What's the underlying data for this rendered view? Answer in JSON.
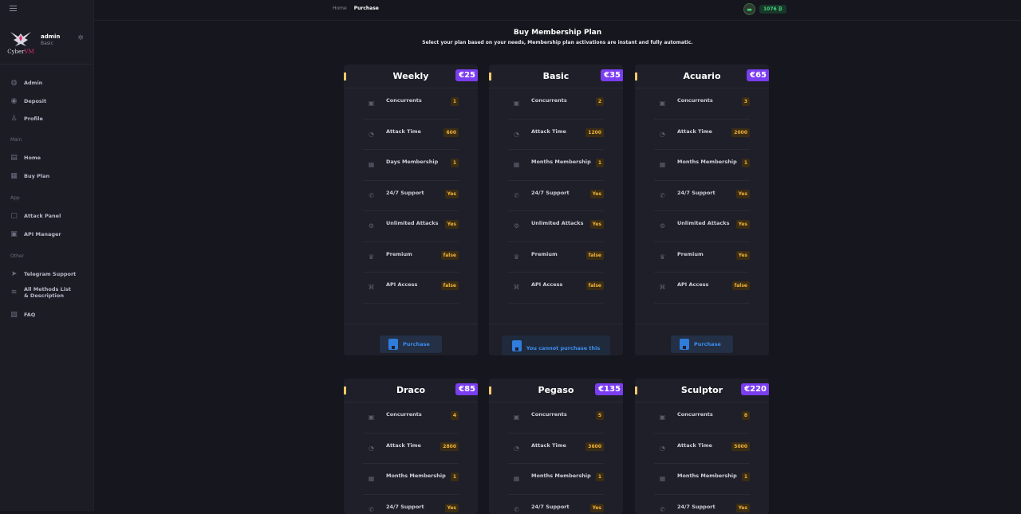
{
  "sidebar": {
    "user": {
      "name": "admin",
      "role": "Basic",
      "logo_text": "CyberVM"
    },
    "top_items": [
      {
        "label": "Admin",
        "icon": "admin-icon"
      },
      {
        "label": "Deposit",
        "icon": "coin-icon"
      },
      {
        "label": "Profile",
        "icon": "user-icon"
      }
    ],
    "sections": [
      {
        "title": "Main",
        "items": [
          {
            "label": "Home",
            "icon": "home-icon"
          },
          {
            "label": "Buy Plan",
            "icon": "cart-icon"
          }
        ]
      },
      {
        "title": "App",
        "items": [
          {
            "label": "Attack Panel",
            "icon": "panel-icon"
          },
          {
            "label": "API Manager",
            "icon": "api-icon"
          }
        ]
      },
      {
        "title": "Other",
        "items": [
          {
            "label": "Telegram Support",
            "icon": "telegram-icon"
          },
          {
            "label": "All Methods List & Description",
            "icon": "list-icon"
          },
          {
            "label": "FAQ",
            "icon": "faq-icon"
          }
        ]
      }
    ]
  },
  "topbar": {
    "breadcrumbs": [
      "Home",
      "Purchase"
    ],
    "balance": "1076 ₿"
  },
  "page": {
    "title": "Buy Membership Plan",
    "subtitle": "Select your plan based on your needs, Membership plan activations are instant and fully automatic."
  },
  "buttons": {
    "purchase": "Purchase",
    "cannot_purchase": "You cannot purchase this plan, upgrade to a higher plan"
  },
  "plans": [
    {
      "name": "Weekly",
      "price": "€25",
      "status": "purchase",
      "features": [
        [
          "Concurrents",
          "1"
        ],
        [
          "Attack Time",
          "600"
        ],
        [
          "Days Membership",
          "1"
        ],
        [
          "24/7 Support",
          "Yes"
        ],
        [
          "Unlimited Attacks",
          "Yes"
        ],
        [
          "Premium",
          "false"
        ],
        [
          "API Access",
          "false"
        ]
      ]
    },
    {
      "name": "Basic",
      "price": "€35",
      "status": "current",
      "features": [
        [
          "Concurrents",
          "2"
        ],
        [
          "Attack Time",
          "1200"
        ],
        [
          "Months Membership",
          "1"
        ],
        [
          "24/7 Support",
          "Yes"
        ],
        [
          "Unlimited Attacks",
          "Yes"
        ],
        [
          "Premium",
          "false"
        ],
        [
          "API Access",
          "false"
        ]
      ]
    },
    {
      "name": "Acuario",
      "price": "€65",
      "status": "purchase",
      "features": [
        [
          "Concurrents",
          "3"
        ],
        [
          "Attack Time",
          "2000"
        ],
        [
          "Months Membership",
          "1"
        ],
        [
          "24/7 Support",
          "Yes"
        ],
        [
          "Unlimited Attacks",
          "Yes"
        ],
        [
          "Premium",
          "Yes"
        ],
        [
          "API Access",
          "false"
        ]
      ]
    },
    {
      "name": "Draco",
      "price": "€85",
      "status": "purchase",
      "features": [
        [
          "Concurrents",
          "4"
        ],
        [
          "Attack Time",
          "2800"
        ],
        [
          "Months Membership",
          "1"
        ],
        [
          "24/7 Support",
          "Yes"
        ]
      ]
    },
    {
      "name": "Pegaso",
      "price": "€135",
      "status": "purchase",
      "features": [
        [
          "Concurrents",
          "5"
        ],
        [
          "Attack Time",
          "3600"
        ],
        [
          "Months Membership",
          "1"
        ],
        [
          "24/7 Support",
          "Yes"
        ]
      ]
    },
    {
      "name": "Sculptor",
      "price": "€220",
      "status": "purchase",
      "features": [
        [
          "Concurrents",
          "8"
        ],
        [
          "Attack Time",
          "5000"
        ],
        [
          "Months Membership",
          "1"
        ],
        [
          "24/7 Support",
          "Yes"
        ]
      ]
    }
  ]
}
